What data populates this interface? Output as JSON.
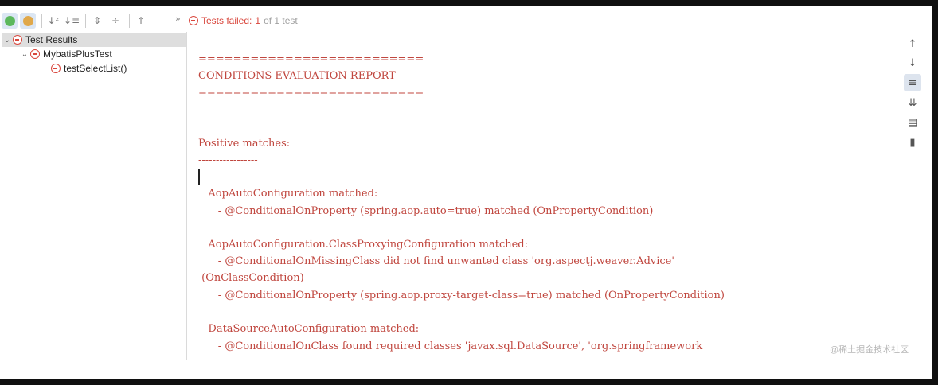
{
  "toolbar": {
    "buttons": [
      {
        "name": "show-passed",
        "icon": "check-circle-icon",
        "color": "#4caf50"
      },
      {
        "name": "show-ignored",
        "icon": "ignored-circle-icon",
        "color": "#d9a03a"
      },
      {
        "name": "sort-alpha",
        "glyph": "↓z"
      },
      {
        "name": "sort-duration",
        "glyph": "↓≡"
      },
      {
        "name": "expand-all",
        "glyph": "⇕"
      },
      {
        "name": "collapse-all",
        "glyph": "⇳"
      },
      {
        "name": "previous-failed",
        "glyph": "↑"
      }
    ],
    "more": "»"
  },
  "status": {
    "failed_label": "Tests failed:",
    "count_label": "1",
    "of_label": "of 1 test"
  },
  "tree": {
    "root": "Test Results",
    "class": "MybatisPlusTest",
    "method": "testSelectList()"
  },
  "console": {
    "lines": [
      "==========================",
      "CONDITIONS EVALUATION REPORT",
      "==========================",
      "",
      "",
      "Positive matches:",
      "-----------------",
      "",
      "   AopAutoConfiguration matched:",
      "      - @ConditionalOnProperty (spring.aop.auto=true) matched (OnPropertyCondition)",
      "",
      "   AopAutoConfiguration.ClassProxyingConfiguration matched:",
      "      - @ConditionalOnMissingClass did not find unwanted class 'org.aspectj.weaver.Advice'",
      " (OnClassCondition)",
      "      - @ConditionalOnProperty (spring.aop.proxy-target-class=true) matched (OnPropertyCondition)",
      "",
      "   DataSourceAutoConfiguration matched:",
      "      - @ConditionalOnClass found required classes 'javax.sql.DataSource', 'org.springframework"
    ],
    "color": "#c0463e"
  },
  "right_tools": [
    {
      "name": "up-arrow-icon",
      "glyph": "↑"
    },
    {
      "name": "down-arrow-icon",
      "glyph": "↓"
    },
    {
      "name": "soft-wrap-icon",
      "glyph": "⇶"
    },
    {
      "name": "scroll-to-end-icon",
      "glyph": "⇊"
    },
    {
      "name": "print-icon",
      "glyph": "⎙"
    },
    {
      "name": "trash-icon",
      "glyph": "🗑"
    }
  ],
  "watermark": "@稀土掘金技术社区"
}
